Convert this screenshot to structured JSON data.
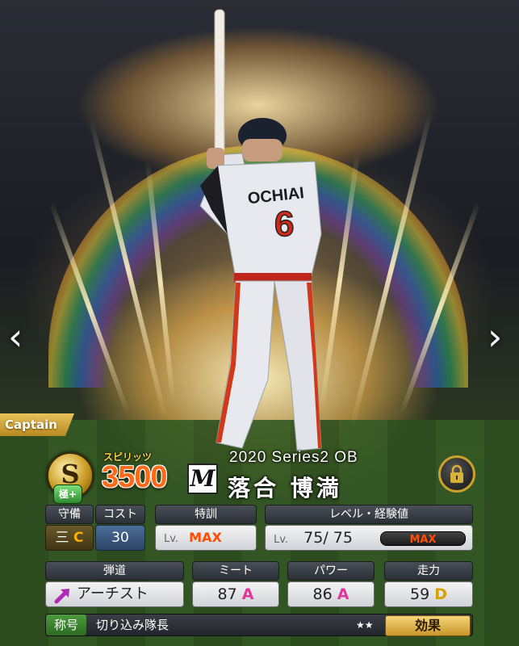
{
  "card": {
    "captain_label": "Captain",
    "rank": "S",
    "rank_tier": "極+",
    "spirits_label": "スピリッツ",
    "spirits_value": "3500",
    "team_logo": "M",
    "series": "2020 Series2 OB",
    "player_name": "落合 博満",
    "lock_icon": "lock-icon"
  },
  "jersey": {
    "name": "OCHIAI",
    "number": "6"
  },
  "stats": {
    "position_header": "守備",
    "cost_header": "コスト",
    "position_value": "三",
    "position_grade": "C",
    "cost_value": "30",
    "special_training_header": "特訓",
    "special_training_lv": "Lv.",
    "special_training_value": "MAX",
    "level_header": "レベル・経験値",
    "level_lv": "Lv.",
    "level_value": "75/ 75",
    "exp_value": "MAX",
    "trajectory_header": "弾道",
    "trajectory_value": "アーチスト",
    "meet_header": "ミート",
    "meet_value": "87",
    "meet_grade": "A",
    "power_header": "パワー",
    "power_value": "86",
    "power_grade": "A",
    "speed_header": "走力",
    "speed_value": "59",
    "speed_grade": "D"
  },
  "title_row": {
    "label": "称号",
    "value": "切り込み隊長",
    "stars": "★★",
    "effect_button": "効果"
  },
  "colors": {
    "accent_gold": "#c99a22",
    "grade_A": "#e0359a",
    "max_orange": "#ff4d00"
  }
}
